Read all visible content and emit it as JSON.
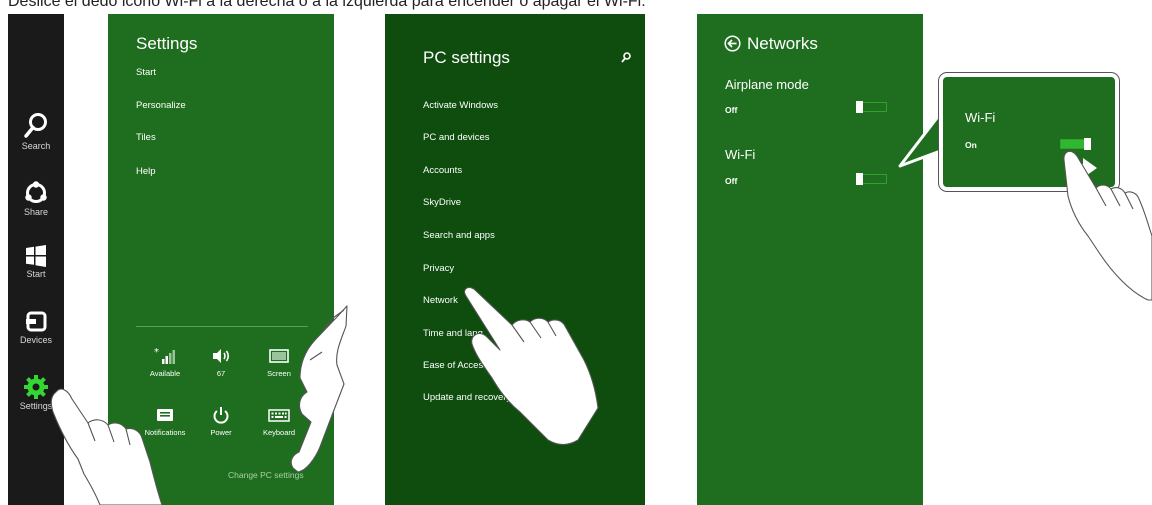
{
  "caption": "Deslice el dedo icono Wi-Fi a la derecha o a la izquierda para encender o apagar el Wi-Fi.",
  "charms": [
    {
      "label": "Search",
      "icon": "search-icon"
    },
    {
      "label": "Share",
      "icon": "share-icon"
    },
    {
      "label": "Start",
      "icon": "windows-icon"
    },
    {
      "label": "Devices",
      "icon": "devices-icon"
    },
    {
      "label": "Settings",
      "icon": "gear-icon"
    }
  ],
  "settings": {
    "title": "Settings",
    "items": [
      "Start",
      "Personalize",
      "Tiles",
      "Help"
    ],
    "tiles": [
      {
        "label": "Available",
        "icon": "signal-icon"
      },
      {
        "label": "67",
        "icon": "volume-icon"
      },
      {
        "label": "Screen",
        "icon": "screen-icon"
      },
      {
        "label": "Notifications",
        "icon": "notifications-icon"
      },
      {
        "label": "Power",
        "icon": "power-icon"
      },
      {
        "label": "Keyboard",
        "icon": "keyboard-icon"
      }
    ],
    "change_link": "Change PC settings"
  },
  "pc_settings": {
    "title": "PC settings",
    "items": [
      "Activate Windows",
      "PC and devices",
      "Accounts",
      "SkyDrive",
      "Search and apps",
      "Privacy",
      "Network",
      "Time and lang",
      "Ease of Access",
      "Update and recovery"
    ]
  },
  "networks": {
    "title": "Networks",
    "airplane_label": "Airplane mode",
    "airplane_state": "Off",
    "wifi_label": "Wi-Fi",
    "wifi_state": "Off"
  },
  "callout": {
    "wifi_label": "Wi-Fi",
    "wifi_state": "On"
  },
  "colors": {
    "panel_green": "#1f6e1f",
    "pc_settings_green": "#0e4d0e",
    "charms_bg": "#1a1a1a",
    "accent_green": "#2fb82f"
  }
}
